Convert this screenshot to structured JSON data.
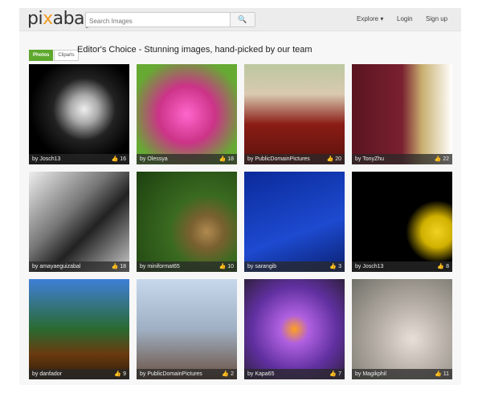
{
  "header": {
    "logo_pre": "pi",
    "logo_x": "x",
    "logo_post": "abay",
    "search_placeholder": "Search Images",
    "search_icon": "🔍",
    "explore": "Explore ▾",
    "login": "Login",
    "signup": "Sign up"
  },
  "filters": {
    "photos": "Photos",
    "cliparts": "Cliparts"
  },
  "title": "Editor's Choice - Stunning images, hand-picked by our team",
  "like_icon": "👍",
  "tiles": [
    {
      "author": "by Josch13",
      "likes": "16",
      "bg": "radial-gradient(circle at 55% 45%,#eee 0,#aaa 18%,#222 40%,#000 70%)"
    },
    {
      "author": "by Olessya",
      "likes": "18",
      "bg": "radial-gradient(circle at 50% 50%,#f6c 0,#c38 40%,#6a3 80%)"
    },
    {
      "author": "by PublicDomainPictures",
      "likes": "20",
      "bg": "linear-gradient(180deg,#bcc8a0 0,#d9c9b0 30%,#8a1d15 60%,#5a120c 100%)"
    },
    {
      "author": "by TonyZhu",
      "likes": "22",
      "bg": "linear-gradient(90deg,#5a1420 0,#7a2030 50%,#c9b070 70%,#fff 100%)"
    },
    {
      "author": "by amayaeguizabal",
      "likes": "18",
      "bg": "linear-gradient(135deg,#eee 0,#777 40%,#222 60%,#ccc 100%)"
    },
    {
      "author": "by miniformat65",
      "likes": "10",
      "bg": "radial-gradient(circle at 70% 60%,#b08a50 0,#7a6030 18%,#3a6a20 40%,#1d4010 100%)"
    },
    {
      "author": "by sarangib",
      "likes": "3",
      "bg": "linear-gradient(160deg,#0b2a9a 0,#1d4ad0 60%,#0a2070 100%)"
    },
    {
      "author": "by Josch13",
      "likes": "8",
      "bg": "radial-gradient(circle at 85% 60%,#f0d020 0,#d0b000 15%,#000 30%,#000 100%)"
    },
    {
      "author": "by danfador",
      "likes": "9",
      "bg": "linear-gradient(180deg,#3f7fd8 0,#2a6a30 50%,#6a3a10 75%,#2a1a08 100%)"
    },
    {
      "author": "by PublicDomainPictures",
      "likes": "2",
      "bg": "linear-gradient(180deg,#c8d8ec 0,#a0b0c4 50%,#6a5040 100%)"
    },
    {
      "author": "by Kapa65",
      "likes": "7",
      "bg": "radial-gradient(circle at 50% 50%,#ffa020 0,#b060e0 20%,#6030a0 60%,#302040 100%)"
    },
    {
      "author": "by Magikphil",
      "likes": "11",
      "bg": "radial-gradient(circle at 60% 60%,#e8e0d8 0,#b8b0a8 40%,#707068 100%)"
    }
  ]
}
